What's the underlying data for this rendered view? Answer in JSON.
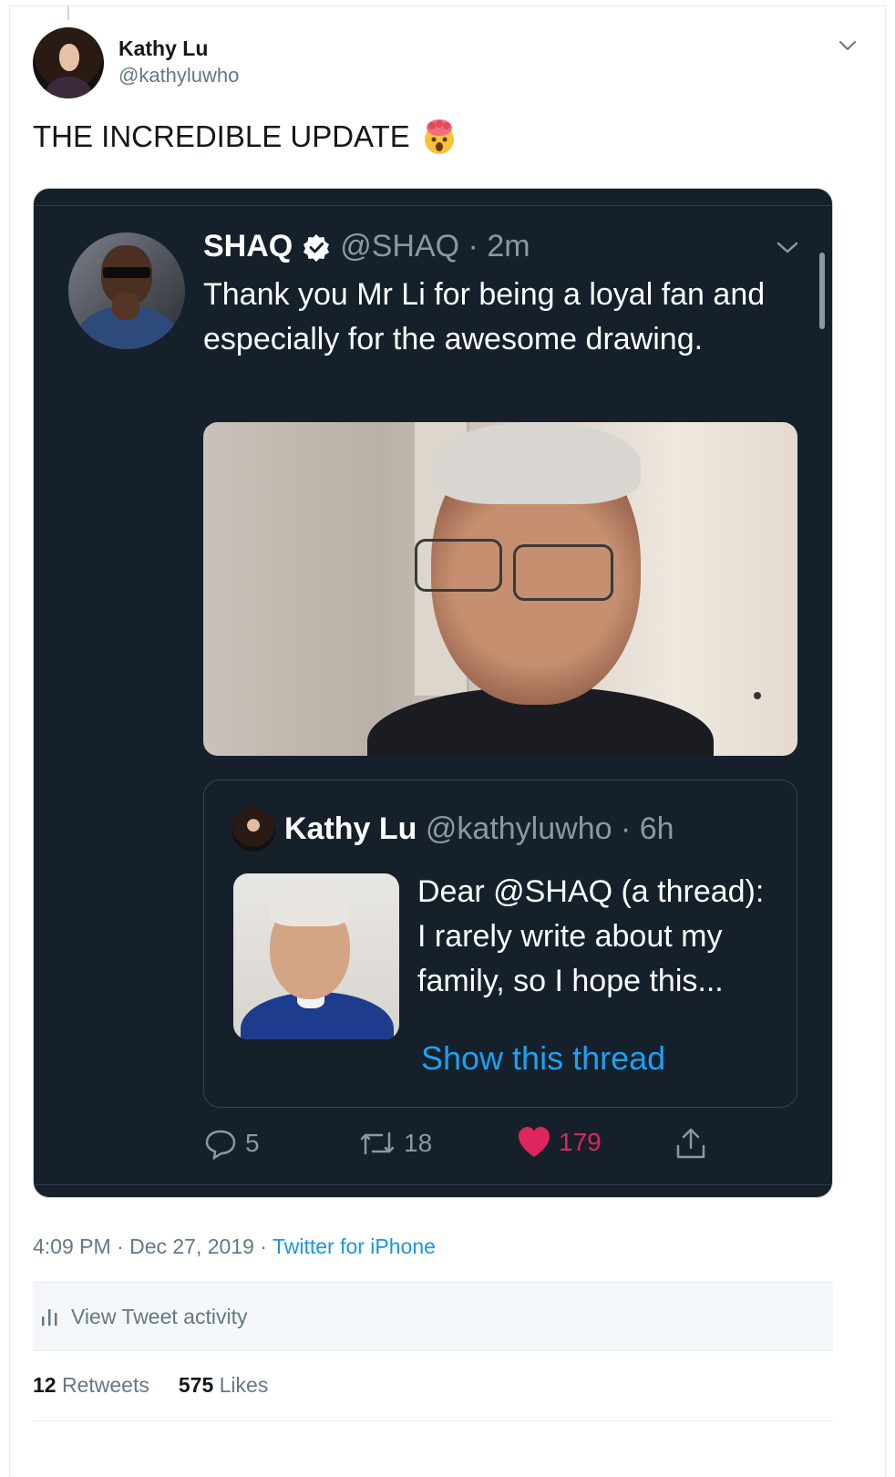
{
  "tweet": {
    "author_name": "Kathy Lu",
    "author_handle": "@kathyluwho",
    "text": "THE INCREDIBLE UPDATE",
    "emoji": "exploding-head-emoji",
    "timestamp": "4:09 PM · Dec 27, 2019 · ",
    "source": "Twitter for iPhone",
    "activity_label": "View Tweet activity",
    "retweets_count": "12",
    "retweets_label": "Retweets",
    "likes_count": "575",
    "likes_label": "Likes"
  },
  "screenshot": {
    "author_name": "SHAQ",
    "meta": "@SHAQ · 2m",
    "text": "Thank you Mr Li for being a loyal fan and especially for the awesome drawing.",
    "quoted": {
      "author_name": "Kathy Lu",
      "meta": "@kathyluwho · 6h",
      "text": "Dear @SHAQ (a thread):\nI rarely write about my family, so I hope this...",
      "link": "Show this thread"
    },
    "replies": "5",
    "retweets": "18",
    "likes": "179"
  },
  "colors": {
    "dark_bg": "#15202b",
    "link_blue": "#1da1f2",
    "like_red": "#e0245e",
    "muted": "#657786"
  }
}
